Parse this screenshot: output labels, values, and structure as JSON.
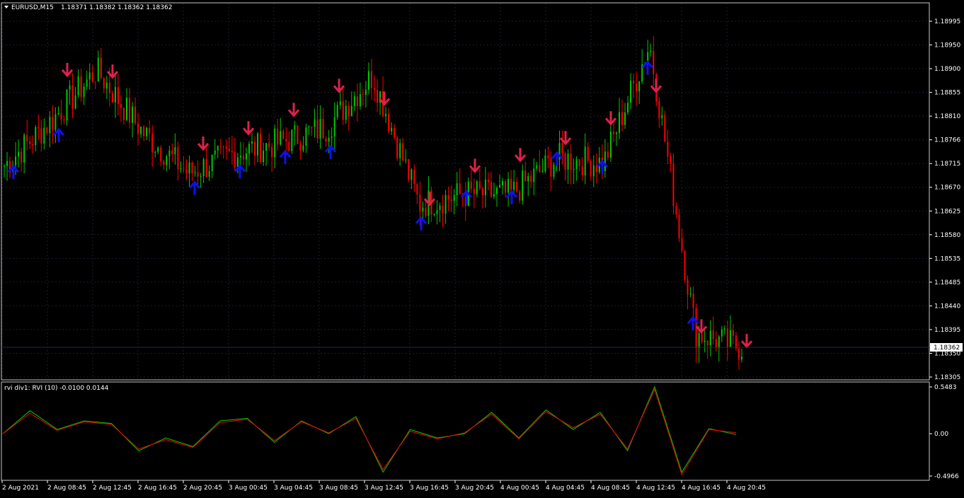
{
  "header": {
    "symbol_timeframe": "EURUSD,M15",
    "ohlc": "1.18371 1.18382 1.18362 1.18362"
  },
  "price_axis": {
    "ticks": [
      "1.18995",
      "1.18950",
      "1.18900",
      "1.18855",
      "1.18810",
      "1.18766",
      "1.18715",
      "1.18670",
      "1.18625",
      "1.18580",
      "1.18535",
      "1.18485",
      "1.18440",
      "1.18395",
      "1.18350",
      "1.18305"
    ],
    "current_price_label": "1.18362"
  },
  "indicator": {
    "title": "rvi div1: RVI (10) -0.0100 0.0144",
    "ticks": [
      "0.5483",
      "0.00",
      "-0.4966"
    ]
  },
  "time_axis": {
    "ticks": [
      "2 Aug 2021",
      "2 Aug 08:45",
      "2 Aug 12:45",
      "2 Aug 16:45",
      "2 Aug 20:45",
      "3 Aug 00:45",
      "3 Aug 04:45",
      "3 Aug 08:45",
      "3 Aug 12:45",
      "3 Aug 16:45",
      "3 Aug 20:45",
      "4 Aug 00:45",
      "4 Aug 04:45",
      "4 Aug 08:45",
      "4 Aug 12:45",
      "4 Aug 16:45",
      "4 Aug 20:45"
    ]
  },
  "colors": {
    "background": "#000000",
    "bull_candle": "#00c800",
    "bear_candle": "#ff0000",
    "down_arrow": "#e0204a",
    "up_arrow": "#1010f0",
    "rvi_line": "#00c800",
    "rvi_signal": "#ff0000",
    "grid": "#1c1c2c",
    "axis": "#ffffff"
  },
  "chart_data": [
    {
      "type": "line",
      "title": "EURUSD,M15",
      "ylim": [
        1.18305,
        1.18995
      ],
      "x": [
        "2 Aug 2021",
        "2 Aug 08:45",
        "2 Aug 12:45",
        "2 Aug 16:45",
        "2 Aug 20:45",
        "3 Aug 00:45",
        "3 Aug 04:45",
        "3 Aug 08:45",
        "3 Aug 12:45",
        "3 Aug 16:45",
        "3 Aug 20:45",
        "4 Aug 00:45",
        "4 Aug 04:45",
        "4 Aug 08:45",
        "4 Aug 12:45",
        "4 Aug 16:45",
        "4 Aug 20:45"
      ],
      "series": [
        {
          "values": [
            1.18715,
            1.188,
            1.189,
            1.1878,
            1.187,
            1.1874,
            1.1876,
            1.1879,
            1.1889,
            1.1864,
            1.1866,
            1.1866,
            1.1873,
            1.1872,
            1.1895,
            1.1839,
            1.18362
          ]
        }
      ],
      "down_signals_x": [
        "2 Aug 08:45",
        "2 Aug 12:45",
        "2 Aug 20:45",
        "3 Aug 00:45",
        "3 Aug 04:45",
        "3 Aug 08:45",
        "3 Aug 12:45",
        "3 Aug 16:45",
        "3 Aug 20:45",
        "4 Aug 00:45",
        "4 Aug 04:45",
        "4 Aug 08:45",
        "4 Aug 12:45",
        "4 Aug 16:45",
        "4 Aug 20:45"
      ],
      "up_signals_x": [
        "2 Aug 2021",
        "2 Aug 08:45",
        "2 Aug 20:45",
        "3 Aug 00:45",
        "3 Aug 04:45",
        "3 Aug 08:45",
        "3 Aug 16:45",
        "3 Aug 20:45",
        "4 Aug 00:45",
        "4 Aug 04:45",
        "4 Aug 08:45",
        "4 Aug 12:45",
        "4 Aug 16:45"
      ]
    },
    {
      "type": "line",
      "title": "rvi div1: RVI (10) -0.0100 0.0144",
      "ylim": [
        -0.4966,
        0.5483
      ],
      "series": [
        {
          "values": [
            0.0,
            0.27,
            0.05,
            0.15,
            0.12,
            -0.2,
            -0.05,
            -0.15,
            0.15,
            0.18,
            -0.1,
            0.15,
            0.0,
            0.2,
            -0.45,
            0.05,
            -0.05,
            0.0,
            0.25,
            -0.05,
            0.28,
            0.05,
            0.25,
            -0.2,
            0.55,
            -0.45,
            0.06,
            -0.01
          ]
        },
        {
          "values": [
            0.0,
            0.24,
            0.04,
            0.14,
            0.11,
            -0.18,
            -0.07,
            -0.16,
            0.13,
            0.17,
            -0.08,
            0.14,
            0.01,
            0.18,
            -0.42,
            0.03,
            -0.06,
            0.01,
            0.23,
            -0.06,
            0.26,
            0.07,
            0.23,
            -0.18,
            0.52,
            -0.48,
            0.05,
            0.01
          ]
        }
      ]
    }
  ]
}
